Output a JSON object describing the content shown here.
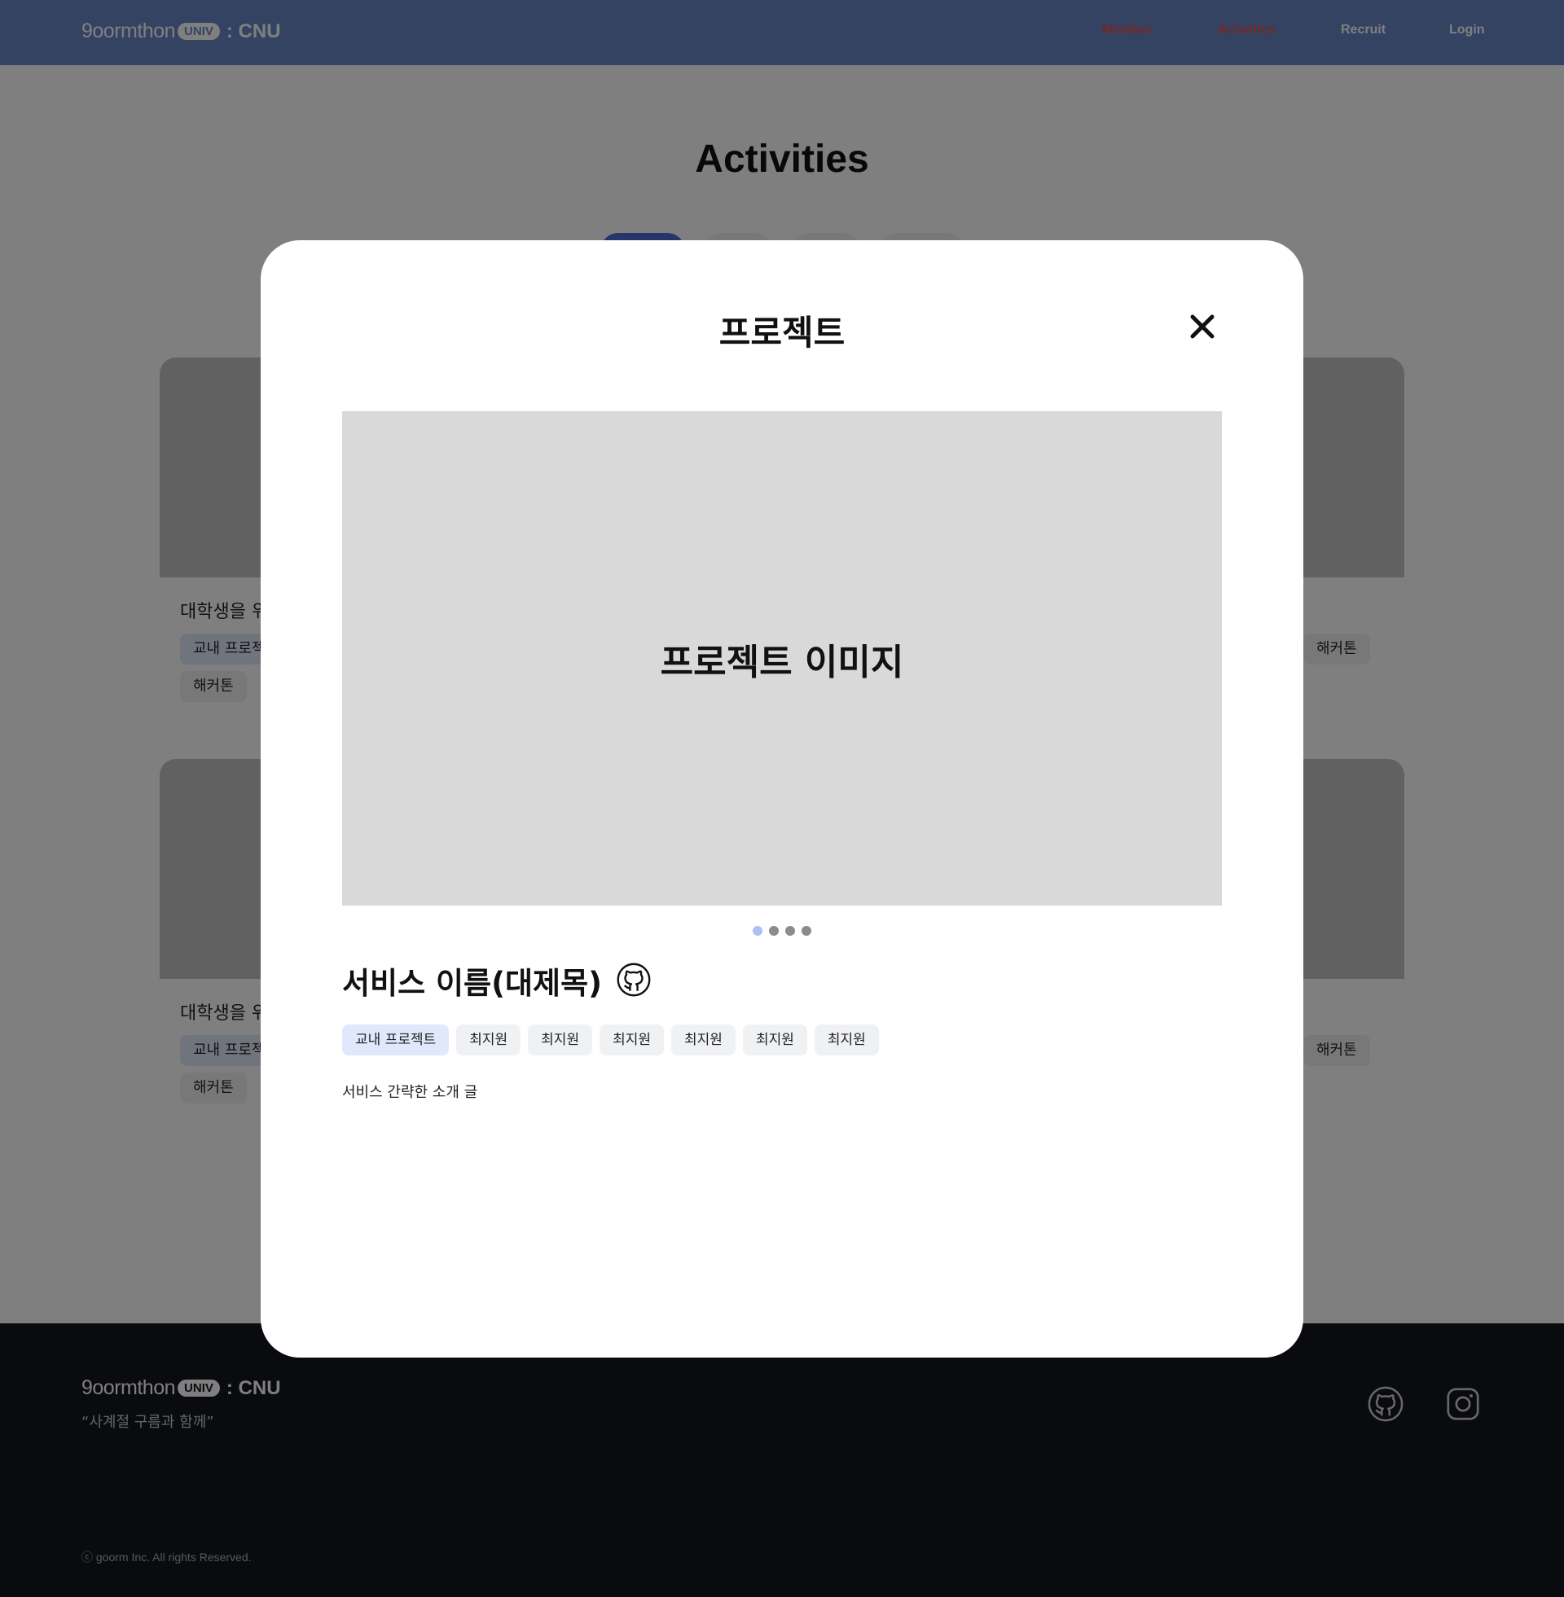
{
  "header": {
    "logo": {
      "goorm": "9oormthon",
      "univ": "UNIV",
      "cnu": ": CNU"
    },
    "nav": [
      {
        "label": "Member"
      },
      {
        "label": "Activities"
      },
      {
        "label": "Recruit"
      },
      {
        "label": "Login"
      }
    ]
  },
  "page": {
    "title": "Activities",
    "cards": [
      {
        "title": "대학생을 위",
        "tag1": "교내 프로젝",
        "tag2": "해커톤"
      },
      {
        "title": "",
        "tag1": "해커톤"
      },
      {
        "title": "대학생을 위",
        "tag1": "교내 프로젝",
        "tag2": "해커톤"
      },
      {
        "title": "",
        "tag1": "해커톤"
      }
    ]
  },
  "modal": {
    "title": "프로젝트",
    "image_label": "프로젝트 이미지",
    "carousel": {
      "count": 4,
      "active_index": 0
    },
    "service_title": "서비스 이름(대제목)",
    "tags": [
      "교내 프로젝트",
      "최지원",
      "최지원",
      "최지원",
      "최지원",
      "최지원",
      "최지원"
    ],
    "description": "서비스 간략한 소개 글"
  },
  "footer": {
    "logo": {
      "goorm": "9oormthon",
      "univ": "UNIV",
      "cnu": ": CNU"
    },
    "slogan": "“사계절 구름과 함께”",
    "copyright": "ⓒ goorm Inc. All rights Reserved."
  },
  "icons": {
    "close": "close-icon",
    "github": "github-icon",
    "instagram": "instagram-icon"
  },
  "colors": {
    "header_bg": "#6b86c6",
    "nav_active": "#e5534b",
    "footer_bg": "#15171d",
    "chip_blue": "#e0e8fb",
    "dot_active": "#a9c1f4"
  }
}
